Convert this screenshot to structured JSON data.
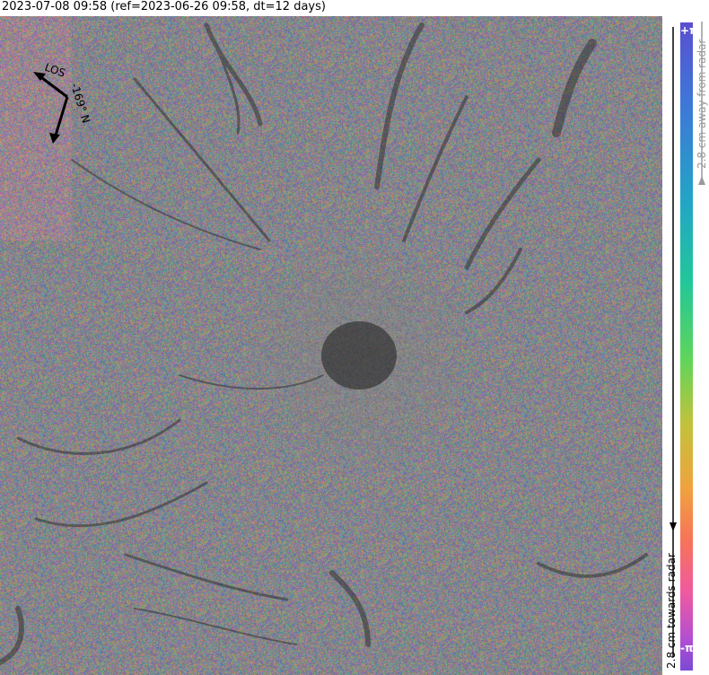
{
  "header": {
    "title": "2023-07-08 09:58 (ref=2023-06-26 09:58, dt=12 days)"
  },
  "map": {
    "compass": {
      "los_label": "LOS",
      "heading_label": "-169° N"
    }
  },
  "colorbar": {
    "top_label": "+π",
    "bottom_label": "-π",
    "away_text": "2.8 cm away from radar",
    "towards_text": "2.8 cm towards radar",
    "colors": [
      "#5a4fcf",
      "#3f76d8",
      "#22a6c6",
      "#22c79a",
      "#5fd55a",
      "#c2c23b",
      "#f0a23e",
      "#f7735a",
      "#ef5aa0",
      "#b44fd1",
      "#7a4ad6"
    ]
  }
}
